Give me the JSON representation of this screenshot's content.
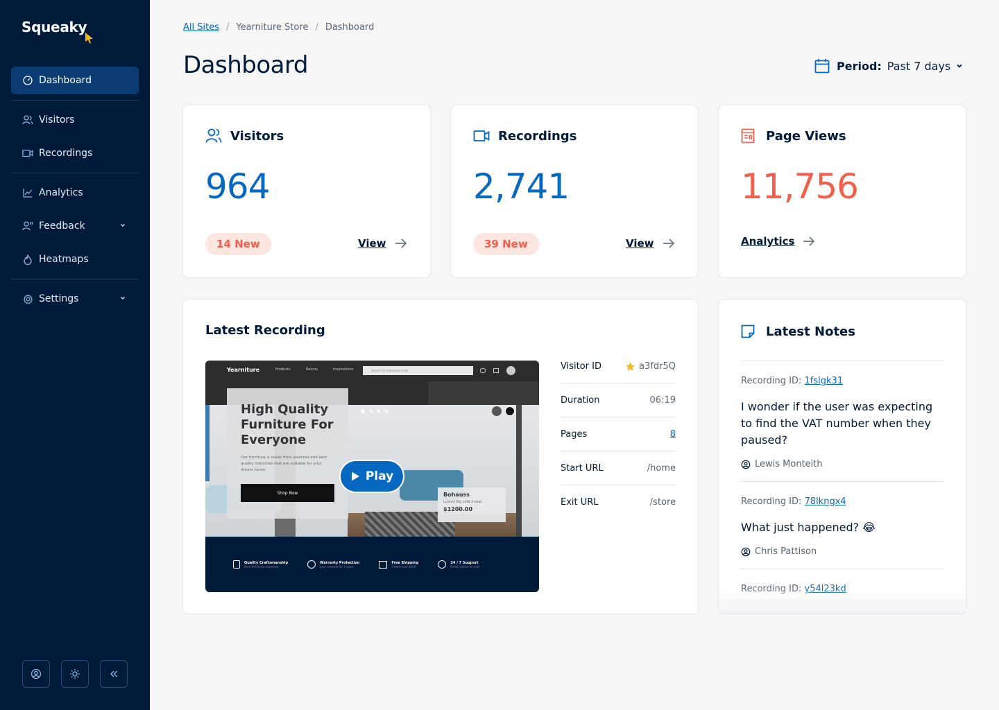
{
  "app": {
    "logo": "Squeaky"
  },
  "sidebar": {
    "items": [
      {
        "label": "Dashboard"
      },
      {
        "label": "Visitors"
      },
      {
        "label": "Recordings"
      },
      {
        "label": "Analytics"
      },
      {
        "label": "Feedback"
      },
      {
        "label": "Heatmaps"
      },
      {
        "label": "Settings"
      }
    ]
  },
  "breadcrumb": {
    "root": "All Sites",
    "site": "Yearniture Store",
    "current": "Dashboard"
  },
  "header": {
    "title": "Dashboard",
    "period_label": "Period:",
    "period_value": "Past 7 days"
  },
  "stats": {
    "visitors": {
      "title": "Visitors",
      "value": "964",
      "badge": "14 New",
      "link": "View"
    },
    "recordings": {
      "title": "Recordings",
      "value": "2,741",
      "badge": "39 New",
      "link": "View"
    },
    "pageviews": {
      "title": "Page Views",
      "value": "11,756",
      "link": "Analytics"
    }
  },
  "latest_recording": {
    "title": "Latest Recording",
    "play_label": "Play",
    "preview": {
      "brand": "Yearniture",
      "menu": [
        "Products",
        "Rooms",
        "Inspirations"
      ],
      "search_placeholder": "Search for minimalist chair",
      "hero_title": "High Quality Furniture For Everyone",
      "hero_text": "Our furniture is made from selected and best quality materials that are suitable for your dream home",
      "hero_button": "Shop Now",
      "product_name": "Bohauss",
      "product_desc": "Luxury big sofa 2-seat",
      "product_price": "$1200.00",
      "features": [
        {
          "title": "Quality Craftsmanship",
          "sub": "from the finest materials"
        },
        {
          "title": "Warranty Protection",
          "sub": "your covered for 2 years"
        },
        {
          "title": "Free Shipping",
          "sub": "Orders over $150"
        },
        {
          "title": "24 / 7 Support",
          "sub": "Email, phone or chat"
        }
      ]
    },
    "meta": [
      {
        "key": "Visitor ID",
        "value": "a3fdr5Q"
      },
      {
        "key": "Duration",
        "value": "06:19"
      },
      {
        "key": "Pages",
        "value": "8"
      },
      {
        "key": "Start URL",
        "value": "/home"
      },
      {
        "key": "Exit URL",
        "value": "/store"
      }
    ]
  },
  "notes": {
    "title": "Latest Notes",
    "id_prefix": "Recording ID:",
    "items": [
      {
        "id": "1fslgk31",
        "text": "I wonder if the user was expecting to find the VAT number when they paused?",
        "author": "Lewis Monteith"
      },
      {
        "id": "78lkngx4",
        "text": "What just happened? 😂",
        "author": "Chris Pattison"
      },
      {
        "id": "y54l23kd"
      }
    ]
  },
  "colors": {
    "navy": "#001a39",
    "blue": "#0768c1",
    "coral": "#f0604d",
    "badge_bg": "#fde6e0",
    "star": "#f5b51c"
  },
  "icons": [
    "dashboard-icon",
    "visitors-icon",
    "recordings-icon",
    "analytics-icon",
    "feedback-icon",
    "heatmaps-icon",
    "settings-icon",
    "calendar-icon",
    "page-views-icon",
    "notes-icon",
    "star-icon",
    "user-icon",
    "sun-icon",
    "collapse-icon",
    "play-icon",
    "arrow-right-icon",
    "chevron-down-icon"
  ]
}
